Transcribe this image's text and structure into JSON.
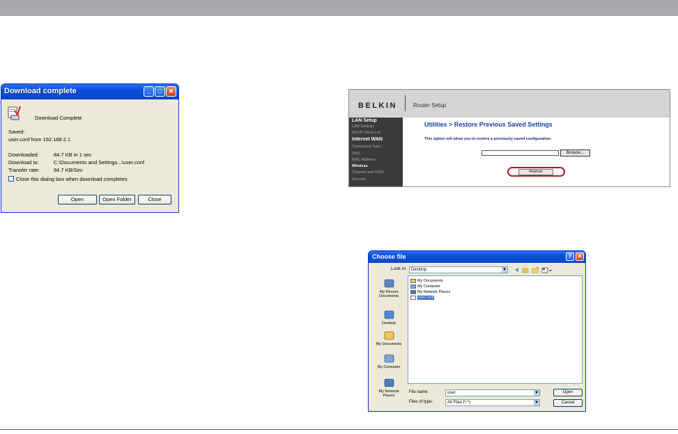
{
  "download_dialog": {
    "title": "Download complete",
    "heading": "Download Complete",
    "saved_label": "Saved:",
    "saved_value": "user.conf from 192.168.2.1",
    "downloaded_label": "Downloaded:",
    "downloaded_value": "84.7 KB in 1 sec",
    "download_to_label": "Download to:",
    "download_to_value": "C:\\Documents and Settings...\\user.conf",
    "transfer_rate_label": "Transfer rate:",
    "transfer_rate_value": "84.7 KB/Sec",
    "close_checkbox_label": "Close this dialog box when download completes",
    "open_button": "Open",
    "open_folder_button": "Open Folder",
    "close_button": "Close"
  },
  "router": {
    "brand": "BELKIN",
    "header": "Router Setup",
    "sidebar": [
      {
        "label": "LAN Setup",
        "style": "heading"
      },
      {
        "label": "LAN Settings",
        "style": "item"
      },
      {
        "label": "DHCP Client List",
        "style": "item"
      },
      {
        "label": "Internet WAN",
        "style": "heading"
      },
      {
        "label": "Connection Type",
        "style": "item"
      },
      {
        "label": "DNS",
        "style": "item"
      },
      {
        "label": "MAC Address",
        "style": "item"
      },
      {
        "label": "Wireless",
        "style": "subheading"
      },
      {
        "label": "Channel and SSID",
        "style": "item"
      },
      {
        "label": "Security",
        "style": "item"
      }
    ],
    "page_title": "Utilities > Restore Previous Saved Settings",
    "description": "This option will allow you to restore a previously saved configuration.",
    "file_input_value": "",
    "browse_button": "Browse...",
    "restore_button": "Restore",
    "highlight_color": "#a02020"
  },
  "choose_file": {
    "title": "Choose file",
    "look_in_label": "Look in:",
    "look_in_value": "Desktop",
    "places": [
      "My Recent Documents",
      "Desktop",
      "My Documents",
      "My Computer",
      "My Network Places"
    ],
    "files": [
      "My Documents",
      "My Computer",
      "My Network Places",
      "user.conf"
    ],
    "selected_file": "user.conf",
    "file_name_label": "File name:",
    "file_name_value": "user",
    "files_of_type_label": "Files of type:",
    "files_of_type_value": "All Files (*.*)",
    "open_button": "Open",
    "cancel_button": "Cancel"
  }
}
